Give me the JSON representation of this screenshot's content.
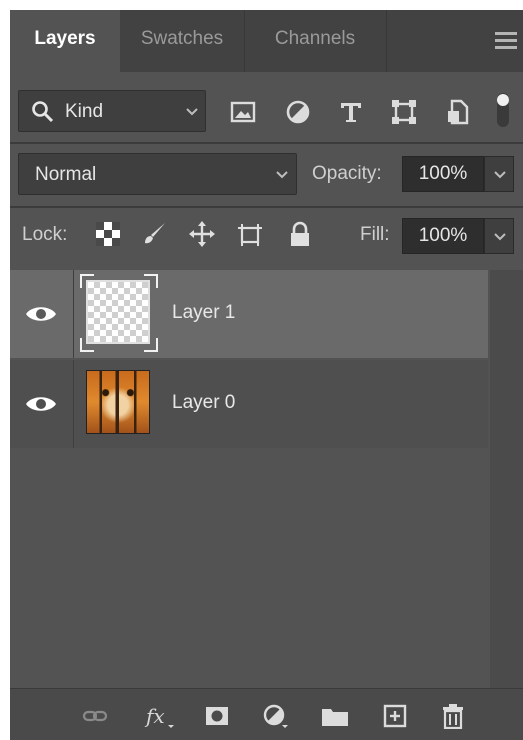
{
  "tabs": [
    {
      "label": "Layers",
      "active": true
    },
    {
      "label": "Swatches",
      "active": false
    },
    {
      "label": "Channels",
      "active": false
    }
  ],
  "filter": {
    "kind_label": "Kind",
    "icons": [
      "image-filter-icon",
      "adjustment-filter-icon",
      "type-filter-icon",
      "shape-filter-icon",
      "smart-object-filter-icon"
    ]
  },
  "blend": {
    "mode": "Normal",
    "opacity_label": "Opacity:",
    "opacity_value": "100%"
  },
  "lock": {
    "label": "Lock:",
    "fill_label": "Fill:",
    "fill_value": "100%"
  },
  "layers": [
    {
      "name": "Layer 1",
      "visible": true,
      "selected": true,
      "thumbnail": "transparent"
    },
    {
      "name": "Layer 0",
      "visible": true,
      "selected": false,
      "thumbnail": "tiger"
    }
  ],
  "bottom_tools": [
    "link-layers-icon",
    "fx-icon",
    "add-mask-icon",
    "adjustment-layer-icon",
    "new-group-icon",
    "new-layer-icon",
    "delete-layer-icon"
  ],
  "colors": {
    "panel_bg": "#535353",
    "tab_bg": "#424242",
    "selected_row": "#6a6a6a"
  }
}
